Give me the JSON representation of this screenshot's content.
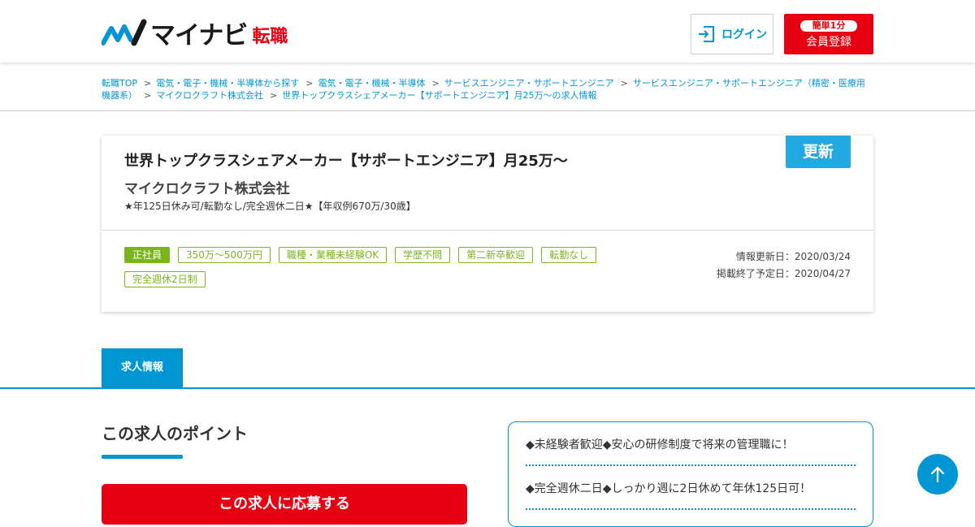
{
  "header": {
    "logo_text": "マイナビ",
    "logo_sub": "転職",
    "login_label": "ログイン",
    "register_badge": "簡単1分",
    "register_label": "会員登録"
  },
  "breadcrumb": [
    "転職TOP",
    "電気・電子・機械・半導体から探す",
    "電気・電子・機械・半導体",
    "サービスエンジニア・サポートエンジニア",
    "サービスエンジニア・サポートエンジニア（精密・医療用機器系）",
    "マイクロクラフト株式会社",
    "世界トップクラスシェアメーカー【サポートエンジニア】月25万～の求人情報"
  ],
  "job": {
    "title": "世界トップクラスシェアメーカー【サポートエンジニア】月25万～",
    "company": "マイクロクラフト株式会社",
    "catch": "★年125日休み可/転勤なし/完全週休二日★【年収例670万/30歳】",
    "update_badge": "更新",
    "tags": [
      "正社員",
      "350万～500万円",
      "職種・業種未経験OK",
      "学歴不問",
      "第二新卒歓迎",
      "転勤なし",
      "完全週休2日制"
    ],
    "updated_date": "情報更新日：2020/03/24",
    "end_date": "掲載終了予定日：2020/04/27"
  },
  "tab": {
    "label": "求人情報"
  },
  "points": {
    "title": "この求人のポイント",
    "apply_label": "この求人に応募する",
    "items": [
      "◆未経験者歓迎◆安心の研修制度で将来の管理職に！",
      "◆完全週休二日◆しっかり週に2日休めて年休125日可！"
    ]
  },
  "colors": {
    "brand_blue": "#0096d6",
    "brand_red": "#e60012",
    "tag_green": "#7ab51d"
  }
}
